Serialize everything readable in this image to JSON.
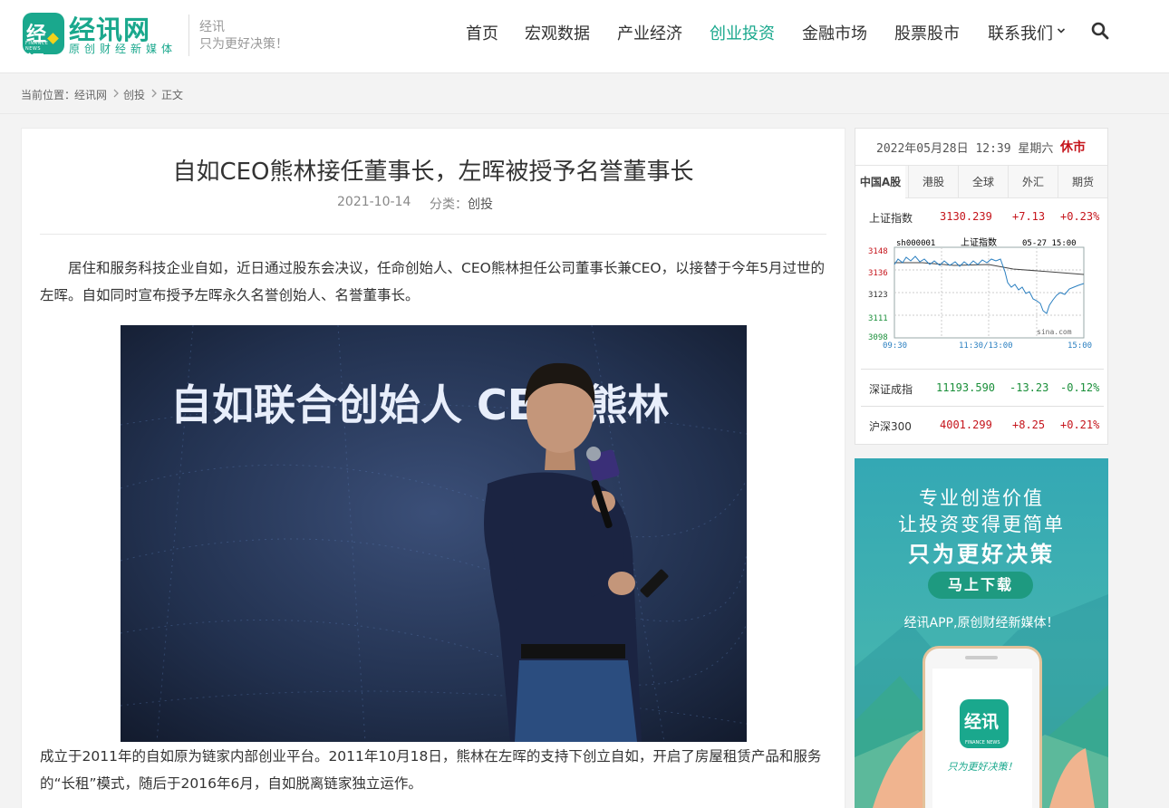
{
  "header": {
    "logo_glyph": "经讯",
    "logo_sub": "FINANCE NEWS",
    "logo_name": "经讯网",
    "logo_tagline": "原创财经新媒体",
    "site_name": "经讯",
    "site_slogan": "只为更好决策！",
    "nav": [
      "首页",
      "宏观数据",
      "产业经济",
      "创业投资",
      "金融市场",
      "股票股市",
      "联系我们"
    ],
    "active_nav": "创业投资",
    "icons": {
      "search": "search-icon",
      "dropdown": "chevron-down-icon"
    },
    "colors": {
      "brand": "#1aa88d"
    }
  },
  "breadcrumb": {
    "prefix": "当前位置：",
    "items": [
      "经讯网",
      "创投",
      "正文"
    ]
  },
  "article": {
    "title": "自如CEO熊林接任董事长，左晖被授予名誉董事长",
    "date": "2021-10-14",
    "category_label": "分类：",
    "category": "创投",
    "para1": "居住和服务科技企业自如，近日通过股东会决议，任命创始人、CEO熊林担任公司董事长兼CEO，以接替于今年5月过世的左晖。自如同时宣布授予左晖永久名誉创始人、名誉董事长。",
    "photo_caption": "自如联合创始人 CEO 熊林",
    "para2": "成立于2011年的自如原为链家内部创业平台。2011年10月18日，熊林在左晖的支持下创立自如，开启了房屋租赁产品和服务的“长租”模式，随后于2016年6月，自如脱离链家独立运作。"
  },
  "market": {
    "datetime": "2022年05月28日  12:39  星期六",
    "status": "休市",
    "tabs": [
      "中国A股",
      "港股",
      "全球",
      "外汇",
      "期货"
    ],
    "active_tab": "中国A股",
    "indices": [
      {
        "name": "上证指数",
        "value": "3130.239",
        "change": "+7.13",
        "pct": "+0.23%",
        "dir": "up"
      },
      {
        "name": "深证成指",
        "value": "11193.590",
        "change": "-13.23",
        "pct": "-0.12%",
        "dir": "down"
      },
      {
        "name": "沪深300",
        "value": "4001.299",
        "change": "+8.25",
        "pct": "+0.21%",
        "dir": "up"
      }
    ],
    "chart_code": "sh000001",
    "chart_name": "上证指数",
    "chart_date": "05-27 15:00",
    "chart_yticks": [
      "3148",
      "3136",
      "3123",
      "3111",
      "3098"
    ],
    "chart_xticks": [
      "09:30",
      "11:30/13:00",
      "15:00"
    ],
    "chart_source": "sina.com",
    "colors": {
      "up": "#c5141b",
      "down": "#1a8f3a",
      "line": "#2a7fc0"
    }
  },
  "ad": {
    "line1": "专业创造价值",
    "line2": "让投资变得更简单",
    "line3": "只为更好决策",
    "button": "马上下载",
    "line4": "经讯APP,原创财经新媒体！",
    "phone_logo": "经讯",
    "phone_logo_sub": "FINANCE NEWS",
    "phone_slogan": "只为更好决策！"
  }
}
